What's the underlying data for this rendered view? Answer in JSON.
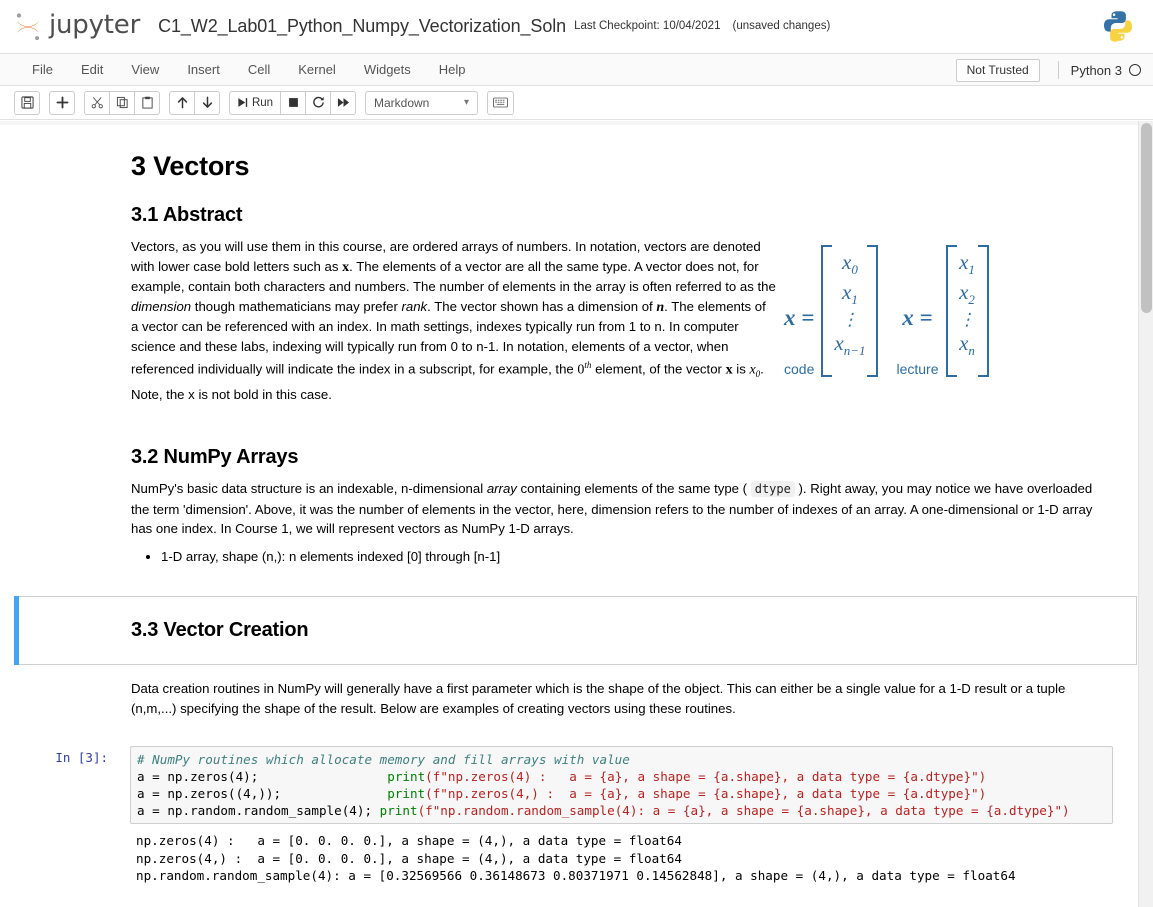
{
  "header": {
    "logo_text": "jupyter",
    "logo_icon": "jupyter-logo-icon",
    "notebook_name": "C1_W2_Lab01_Python_Numpy_Vectorization_Soln",
    "checkpoint": "Last Checkpoint: 10/04/2021",
    "save_state": "(unsaved changes)",
    "python_logo_icon": "python-logo-icon"
  },
  "menubar": {
    "items": [
      {
        "label": "File"
      },
      {
        "label": "Edit"
      },
      {
        "label": "View"
      },
      {
        "label": "Insert"
      },
      {
        "label": "Cell"
      },
      {
        "label": "Kernel"
      },
      {
        "label": "Widgets"
      },
      {
        "label": "Help"
      }
    ],
    "trust_label": "Not Trusted",
    "kernel_name": "Python 3",
    "kernel_status_icon": "kernel-idle-circle-icon"
  },
  "toolbar": {
    "save_icon": "save-disk-icon",
    "insert_icon": "plus-icon",
    "cut_icon": "scissors-icon",
    "copy_icon": "copy-icon",
    "paste_icon": "paste-icon",
    "move_up_icon": "arrow-up-icon",
    "move_down_icon": "arrow-down-icon",
    "run_label": "Run",
    "run_icon": "run-icon",
    "stop_icon": "stop-square-icon",
    "restart_icon": "restart-circular-arrow-icon",
    "restart_run_all_icon": "fast-forward-icon",
    "cell_type_value": "Markdown",
    "cell_type_chevron_icon": "chevron-down-icon",
    "command_palette_icon": "keyboard-icon"
  },
  "notebook": {
    "h1_vectors": "3 Vectors",
    "h2_abstract": "3.1 Abstract",
    "abstract_p1_a": "Vectors, as you will use them in this course, are ordered arrays of numbers. In notation, vectors are denoted with lower case bold letters such as ",
    "abstract_x1": "x",
    "abstract_p1_b": ". The elements of a vector are all the same type. A vector does not, for example, contain both characters and numbers. The number of elements in the array is often referred to as the ",
    "abstract_dimension": "dimension",
    "abstract_p1_c": " though mathematicians may prefer ",
    "abstract_rank": "rank",
    "abstract_p1_d": ". The vector shown has a dimension of ",
    "abstract_n": "n",
    "abstract_p1_e": ". The elements of a vector can be referenced with an index. In math settings, indexes typically run from 1 to n. In computer science and these labs, indexing will typically run from 0 to n-1. In notation, elements of a vector, when referenced individually will indicate the index in a subscript, for example, the ",
    "abstract_zero": "0",
    "abstract_th": "th",
    "abstract_p1_f": " element, of the vector ",
    "abstract_x2": "x",
    "abstract_p1_g": " is ",
    "abstract_x3": "x",
    "abstract_x3sub": "0",
    "abstract_p1_h": ". Note, the x is not bold in this case.",
    "fig_code": {
      "lhs": "x =",
      "caption": "code",
      "items": [
        "x",
        "x",
        "⋮",
        "x"
      ],
      "subs": [
        "0",
        "1",
        "",
        "n−1"
      ]
    },
    "fig_lecture": {
      "lhs": "x =",
      "caption": "lecture",
      "items": [
        "x",
        "x",
        "⋮",
        "x"
      ],
      "subs": [
        "1",
        "2",
        "",
        "n"
      ]
    },
    "h2_numpy_arrays": "3.2 NumPy Arrays",
    "numpy_p1_a": "NumPy's basic data structure is an indexable, n-dimensional ",
    "numpy_array_italic": "array",
    "numpy_p1_b": " containing elements of the same type ( ",
    "numpy_dtype_code": "dtype",
    "numpy_p1_c": " ). Right away, you may notice we have overloaded the term 'dimension'. Above, it was the number of elements in the vector, here, dimension refers to the number of indexes of an array. A one-dimensional or 1-D array has one index. In Course 1, we will represent vectors as NumPy 1-D arrays.",
    "bullet_1": "1-D array, shape (n,): n elements indexed [0] through [n-1]",
    "h2_vector_creation": "3.3 Vector Creation",
    "creation_p1": "Data creation routines in NumPy will generally have a first parameter which is the shape of the object. This can either be a single value for a 1-D result or a tuple (n,m,...) specifying the shape of the result. Below are examples of creating vectors using these routines.",
    "code_cell": {
      "prompt": "In [3]:",
      "lines": [
        {
          "comment": "# NumPy routines which allocate memory and fill arrays with value"
        },
        {
          "lhs": "a = np.zeros(4);",
          "pad": "                 ",
          "fn": "print",
          "str": "(f\"np.zeros(4) :   a = {a}, a shape = {a.shape}, a data type = {a.dtype}\")"
        },
        {
          "lhs": "a = np.zeros((4,));",
          "pad": "              ",
          "fn": "print",
          "str": "(f\"np.zeros(4,) :  a = {a}, a shape = {a.shape}, a data type = {a.dtype}\")"
        },
        {
          "lhs": "a = np.random.random_sample(4);",
          "pad": " ",
          "fn": "print",
          "str": "(f\"np.random.random_sample(4): a = {a}, a shape = {a.shape}, a data type = {a.dtype}\")"
        }
      ],
      "output": "np.zeros(4) :   a = [0. 0. 0. 0.], a shape = (4,), a data type = float64\nnp.zeros(4,) :  a = [0. 0. 0. 0.], a shape = (4,), a data type = float64\nnp.random.random_sample(4): a = [0.32569566 0.36148673 0.80371971 0.14562848], a shape = (4,), a data type = float64"
    }
  },
  "colors": {
    "accent_blue": "#42a5f5",
    "math_blue": "#2e6da4",
    "prompt_blue": "#303f9f",
    "comment_teal": "#408080",
    "string_red": "#ba2121",
    "function_green": "#008000"
  }
}
